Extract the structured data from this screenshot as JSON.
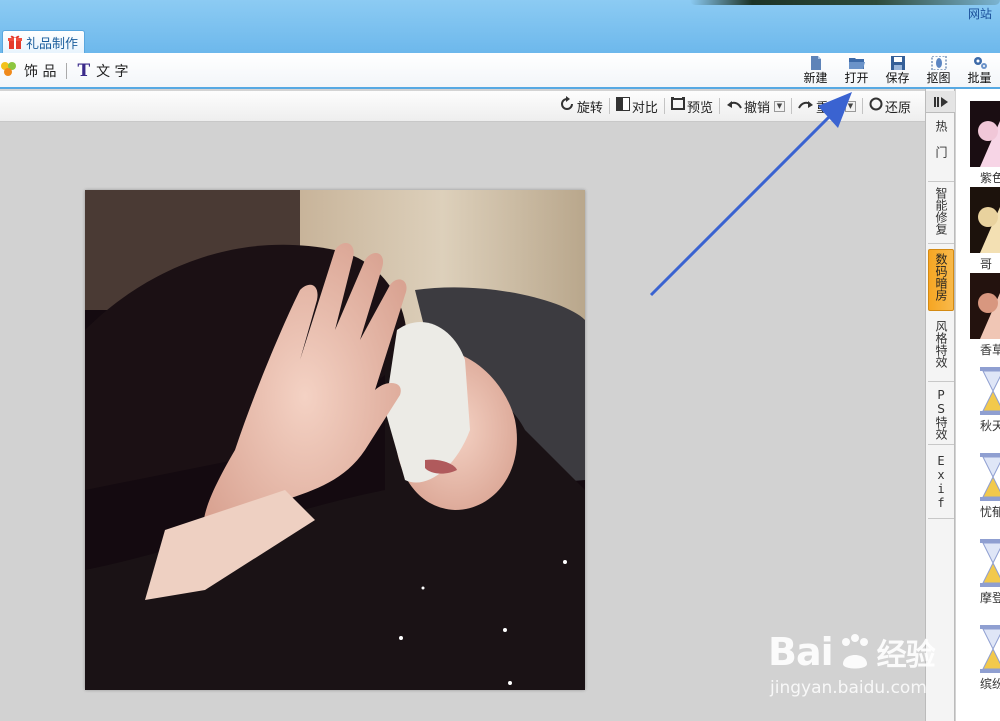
{
  "window": {
    "site_link": "网站",
    "tab_label": "礼品制作"
  },
  "toolbar_left": {
    "decorations_label": "饰 品",
    "text_label": "文 字"
  },
  "toolbar_right": [
    {
      "id": "new",
      "label": "新建",
      "icon": "new-file-icon"
    },
    {
      "id": "open",
      "label": "打开",
      "icon": "open-folder-icon"
    },
    {
      "id": "save",
      "label": "保存",
      "icon": "save-disk-icon"
    },
    {
      "id": "cutout",
      "label": "抠图",
      "icon": "cutout-icon"
    },
    {
      "id": "batch",
      "label": "批量",
      "icon": "batch-gear-icon"
    }
  ],
  "edit_tools": {
    "rotate": "旋转",
    "compare": "对比",
    "preview": "预览",
    "undo": "撤销",
    "redo": "重",
    "restore": "还原"
  },
  "side_tabs": [
    {
      "label": "热门",
      "active": false
    },
    {
      "label": "智能修复",
      "active": false
    },
    {
      "label": "数码暗房",
      "active": true
    },
    {
      "label": "风格特效",
      "active": false
    },
    {
      "label": "PS特效",
      "active": false
    },
    {
      "label": "Exif",
      "active": false
    }
  ],
  "effects": [
    {
      "label": "紫色",
      "kind": "thumb"
    },
    {
      "label": "哥",
      "kind": "thumb"
    },
    {
      "label": "香草",
      "kind": "thumb"
    },
    {
      "label": "秋天",
      "kind": "loading"
    },
    {
      "label": "忧郁",
      "kind": "loading"
    },
    {
      "label": "摩登",
      "kind": "loading"
    },
    {
      "label": "缤纷",
      "kind": "loading"
    }
  ],
  "watermark": {
    "logo_text": "Bai",
    "logo_text2": "经验",
    "url": "jingyan.baidu.com"
  },
  "colors": {
    "accent_blue": "#56a9e3",
    "active_tab_orange": "#f6a623",
    "annotation_arrow": "#3a63d1"
  }
}
